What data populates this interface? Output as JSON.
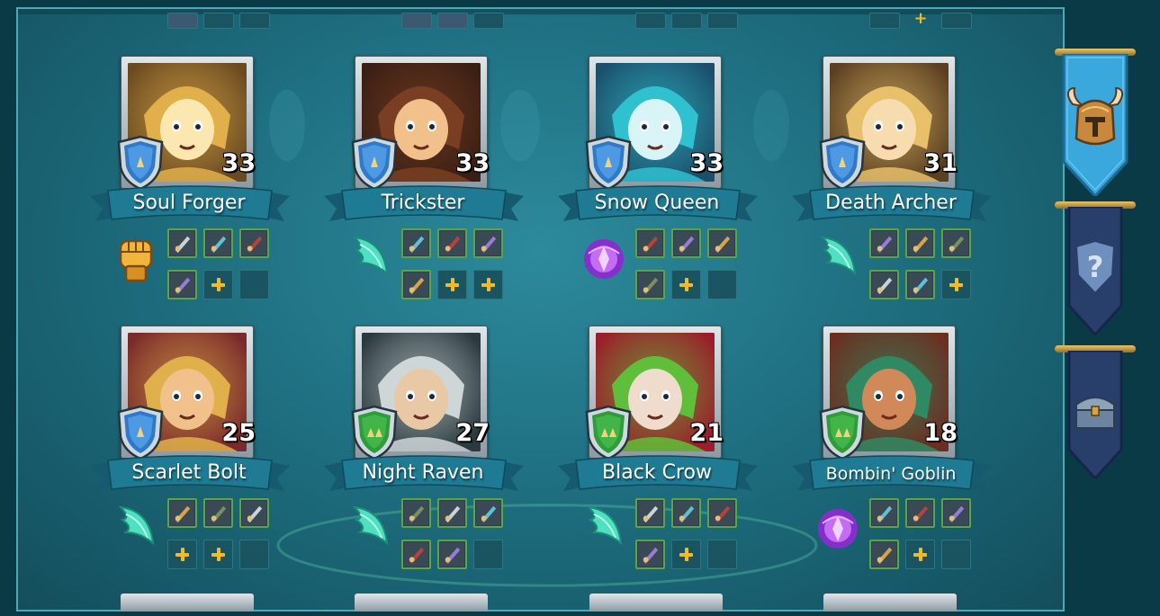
{
  "heroes": [
    {
      "name": "Soul Forger",
      "level": "33",
      "rank": "blue",
      "class_icon": "fist-icon",
      "palette": [
        "#e2b04a",
        "#fbe7b0",
        "#6b4a21"
      ],
      "gear": [
        "gear",
        "gear",
        "gear",
        "gear",
        "plus",
        "empty"
      ]
    },
    {
      "name": "Trickster",
      "level": "33",
      "rank": "blue",
      "class_icon": "wing-icon",
      "palette": [
        "#7a3f22",
        "#f1c08b",
        "#3b1f14"
      ],
      "gear": [
        "gear",
        "gear",
        "gear",
        "gear",
        "plus",
        "plus"
      ]
    },
    {
      "name": "Snow Queen",
      "level": "33",
      "rank": "blue",
      "class_icon": "magic-orb-icon",
      "palette": [
        "#2fc1d0",
        "#d8f4f7",
        "#1b4f6a"
      ],
      "gear": [
        "gear",
        "gear",
        "gear",
        "gear",
        "plus",
        "empty"
      ]
    },
    {
      "name": "Death Archer",
      "level": "31",
      "rank": "blue",
      "class_icon": "wing-icon",
      "palette": [
        "#e8c06a",
        "#f7dcb0",
        "#5a3f21"
      ],
      "gear": [
        "gear",
        "gear",
        "gear",
        "gear",
        "gear",
        "plus"
      ]
    },
    {
      "name": "Scarlet Bolt",
      "level": "25",
      "rank": "blue",
      "class_icon": "wing-icon",
      "palette": [
        "#e0b14a",
        "#f1c08b",
        "#7a2a2a"
      ],
      "gear": [
        "gear",
        "gear",
        "gear",
        "plus",
        "plus",
        "empty"
      ]
    },
    {
      "name": "Night Raven",
      "level": "27",
      "rank": "green",
      "class_icon": "wing-icon",
      "palette": [
        "#cfd6d8",
        "#e9c8a5",
        "#2b3a3f"
      ],
      "gear": [
        "gear",
        "gear",
        "gear",
        "gear",
        "gear",
        "empty"
      ]
    },
    {
      "name": "Black Crow",
      "level": "21",
      "rank": "green",
      "class_icon": "wing-icon",
      "palette": [
        "#5fbf3a",
        "#f0dccc",
        "#9a1f2a"
      ],
      "gear": [
        "gear",
        "gear",
        "gear",
        "gear",
        "plus",
        "empty"
      ]
    },
    {
      "name": "Bombin' Goblin",
      "level": "18",
      "rank": "green",
      "class_icon": "magic-orb-icon",
      "palette": [
        "#2f8a63",
        "#d1895a",
        "#6b2f20"
      ],
      "gear": [
        "gear",
        "gear",
        "gear",
        "gear",
        "plus",
        "empty"
      ]
    }
  ],
  "sidebar": [
    {
      "icon": "horned-helmet-icon",
      "active": true
    },
    {
      "icon": "question-badge-icon",
      "active": false
    },
    {
      "icon": "treasure-chest-icon",
      "active": false
    }
  ],
  "colors": {
    "blue_rank": "#2f79c8",
    "green_rank": "#2f9b3b",
    "plus": "#f5bb1b",
    "ribbon": "#1f7a93"
  }
}
